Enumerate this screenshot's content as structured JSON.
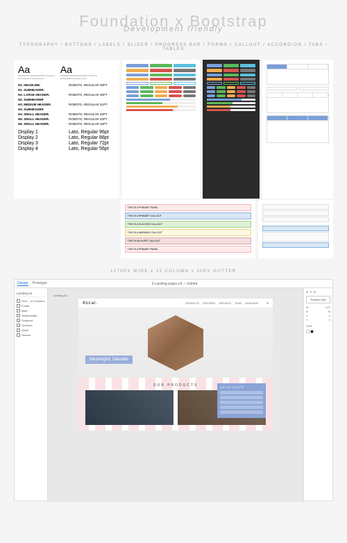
{
  "hero": {
    "title": "Foundation x Bootstrap",
    "subtitle": "Development friendly",
    "categories": "TYPOGRAPHY / BUTTONS / LABELS / SLIDER / PROGRESS BAR / FORMS / CALLOUT / ACCORDION / TABS / TABLES"
  },
  "typography": {
    "aa_label": "Aa",
    "headings": [
      {
        "left": "H1. HEADLINE.",
        "right": "ROBOTO, REGULAR 48PT"
      },
      {
        "left": "H1. SUBHEADER.",
        "right": ""
      },
      {
        "left": "H2. LARGE HEADER.",
        "right": "ROBOTO, REGULAR 40PT"
      },
      {
        "left": "H2. SUBHEADER",
        "right": ""
      },
      {
        "left": "H3. MEDIUM HEADER.",
        "right": "ROBOTO, REGULAR 31PT"
      },
      {
        "left": "H3. SUBHEADER",
        "right": ""
      },
      {
        "left": "H4. SMALL HEADER.",
        "right": "ROBOTO, REGULAR 25PT"
      },
      {
        "left": "H5. SMALL HEADER.",
        "right": "ROBOTO, REGULAR 20PT"
      },
      {
        "left": "H6. SMALL HEADER.",
        "right": "ROBOTO, REGULAR 16PT"
      }
    ],
    "displays": [
      {
        "left": "Display 1",
        "right": "Lato, Regular 96pt"
      },
      {
        "left": "Display 2",
        "right": "Lato, Regular 88pt"
      },
      {
        "left": "Display 3",
        "right": "Lato, Regular 72pt"
      },
      {
        "left": "Display 4",
        "right": "Lato, Regular 56pt"
      }
    ]
  },
  "colors": {
    "blue": "#7a9ed8",
    "green": "#5cb85c",
    "teal": "#5bc0de",
    "orange": "#f0ad4e",
    "red": "#d9534f",
    "gray": "#777",
    "ltgray": "#ccc",
    "dark": "#333",
    "pink": "#f7c6cc",
    "ltblue": "#d8e7f5",
    "ltgreen": "#dff0d8",
    "ltyellow": "#fcf8e3",
    "ltred": "#f2dede"
  },
  "callouts": [
    {
      "text": "THIS IS A PRIMARY PANEL",
      "bg": "#fdebec",
      "border": "#f5b7bd"
    },
    {
      "text": "THIS IS A PRIMARY CALLOUT",
      "bg": "#d8e7f5",
      "border": "#8ab4e0"
    },
    {
      "text": "THIS IS A SUCCESS CALLOUT",
      "bg": "#dff0d8",
      "border": "#a3d48e"
    },
    {
      "text": "THIS IS A WARNING CALLOUT",
      "bg": "#fcf8e3",
      "border": "#e8d77b"
    },
    {
      "text": "THIS IS AN ALERT CALLOUT",
      "bg": "#f2dede",
      "border": "#e0a3a3"
    },
    {
      "text": "THIS IS A PRIMARY PANEL",
      "bg": "#fdebec",
      "border": "#f5b7bd"
    }
  ],
  "grid": {
    "title": "1170PX WIDE x 12 COLUMN x 30PX GUTTER"
  },
  "xd": {
    "tabs": [
      "Design",
      "Prototype"
    ],
    "file_name": "5.Landing pages.xd",
    "file_status": "Edited",
    "artboard_tab": "Landing A4",
    "left_panel": [
      {
        "icon": "rect",
        "label": "Grid – 12 Columns"
      },
      {
        "icon": "rect",
        "label": "Footer"
      },
      {
        "icon": "rect",
        "label": "Main"
      },
      {
        "icon": "text",
        "label": "Testimonials"
      },
      {
        "icon": "rect",
        "label": "Featured"
      },
      {
        "icon": "text",
        "label": "Services"
      },
      {
        "icon": "rect",
        "label": "Slider"
      },
      {
        "icon": "rect",
        "label": "Header"
      }
    ],
    "right_panel": {
      "repeat_grid": "Repeat Grid",
      "w_label": "W",
      "w_val": "1170",
      "h_label": "H",
      "h_val": "20",
      "x_label": "X",
      "x_val": "0",
      "y_label": "Y",
      "y_val": "0",
      "opacity": "100%"
    },
    "landing": {
      "logo": "4ocal.",
      "nav": [
        "PRODUCTS",
        "FEATURES",
        "SERVICES",
        "TEAM",
        "LANGUAGE"
      ],
      "headline": "Meaningful, Valuable",
      "section_title": "OUR PRODUCTS",
      "quote_title": "QUICK QUOTE"
    }
  }
}
